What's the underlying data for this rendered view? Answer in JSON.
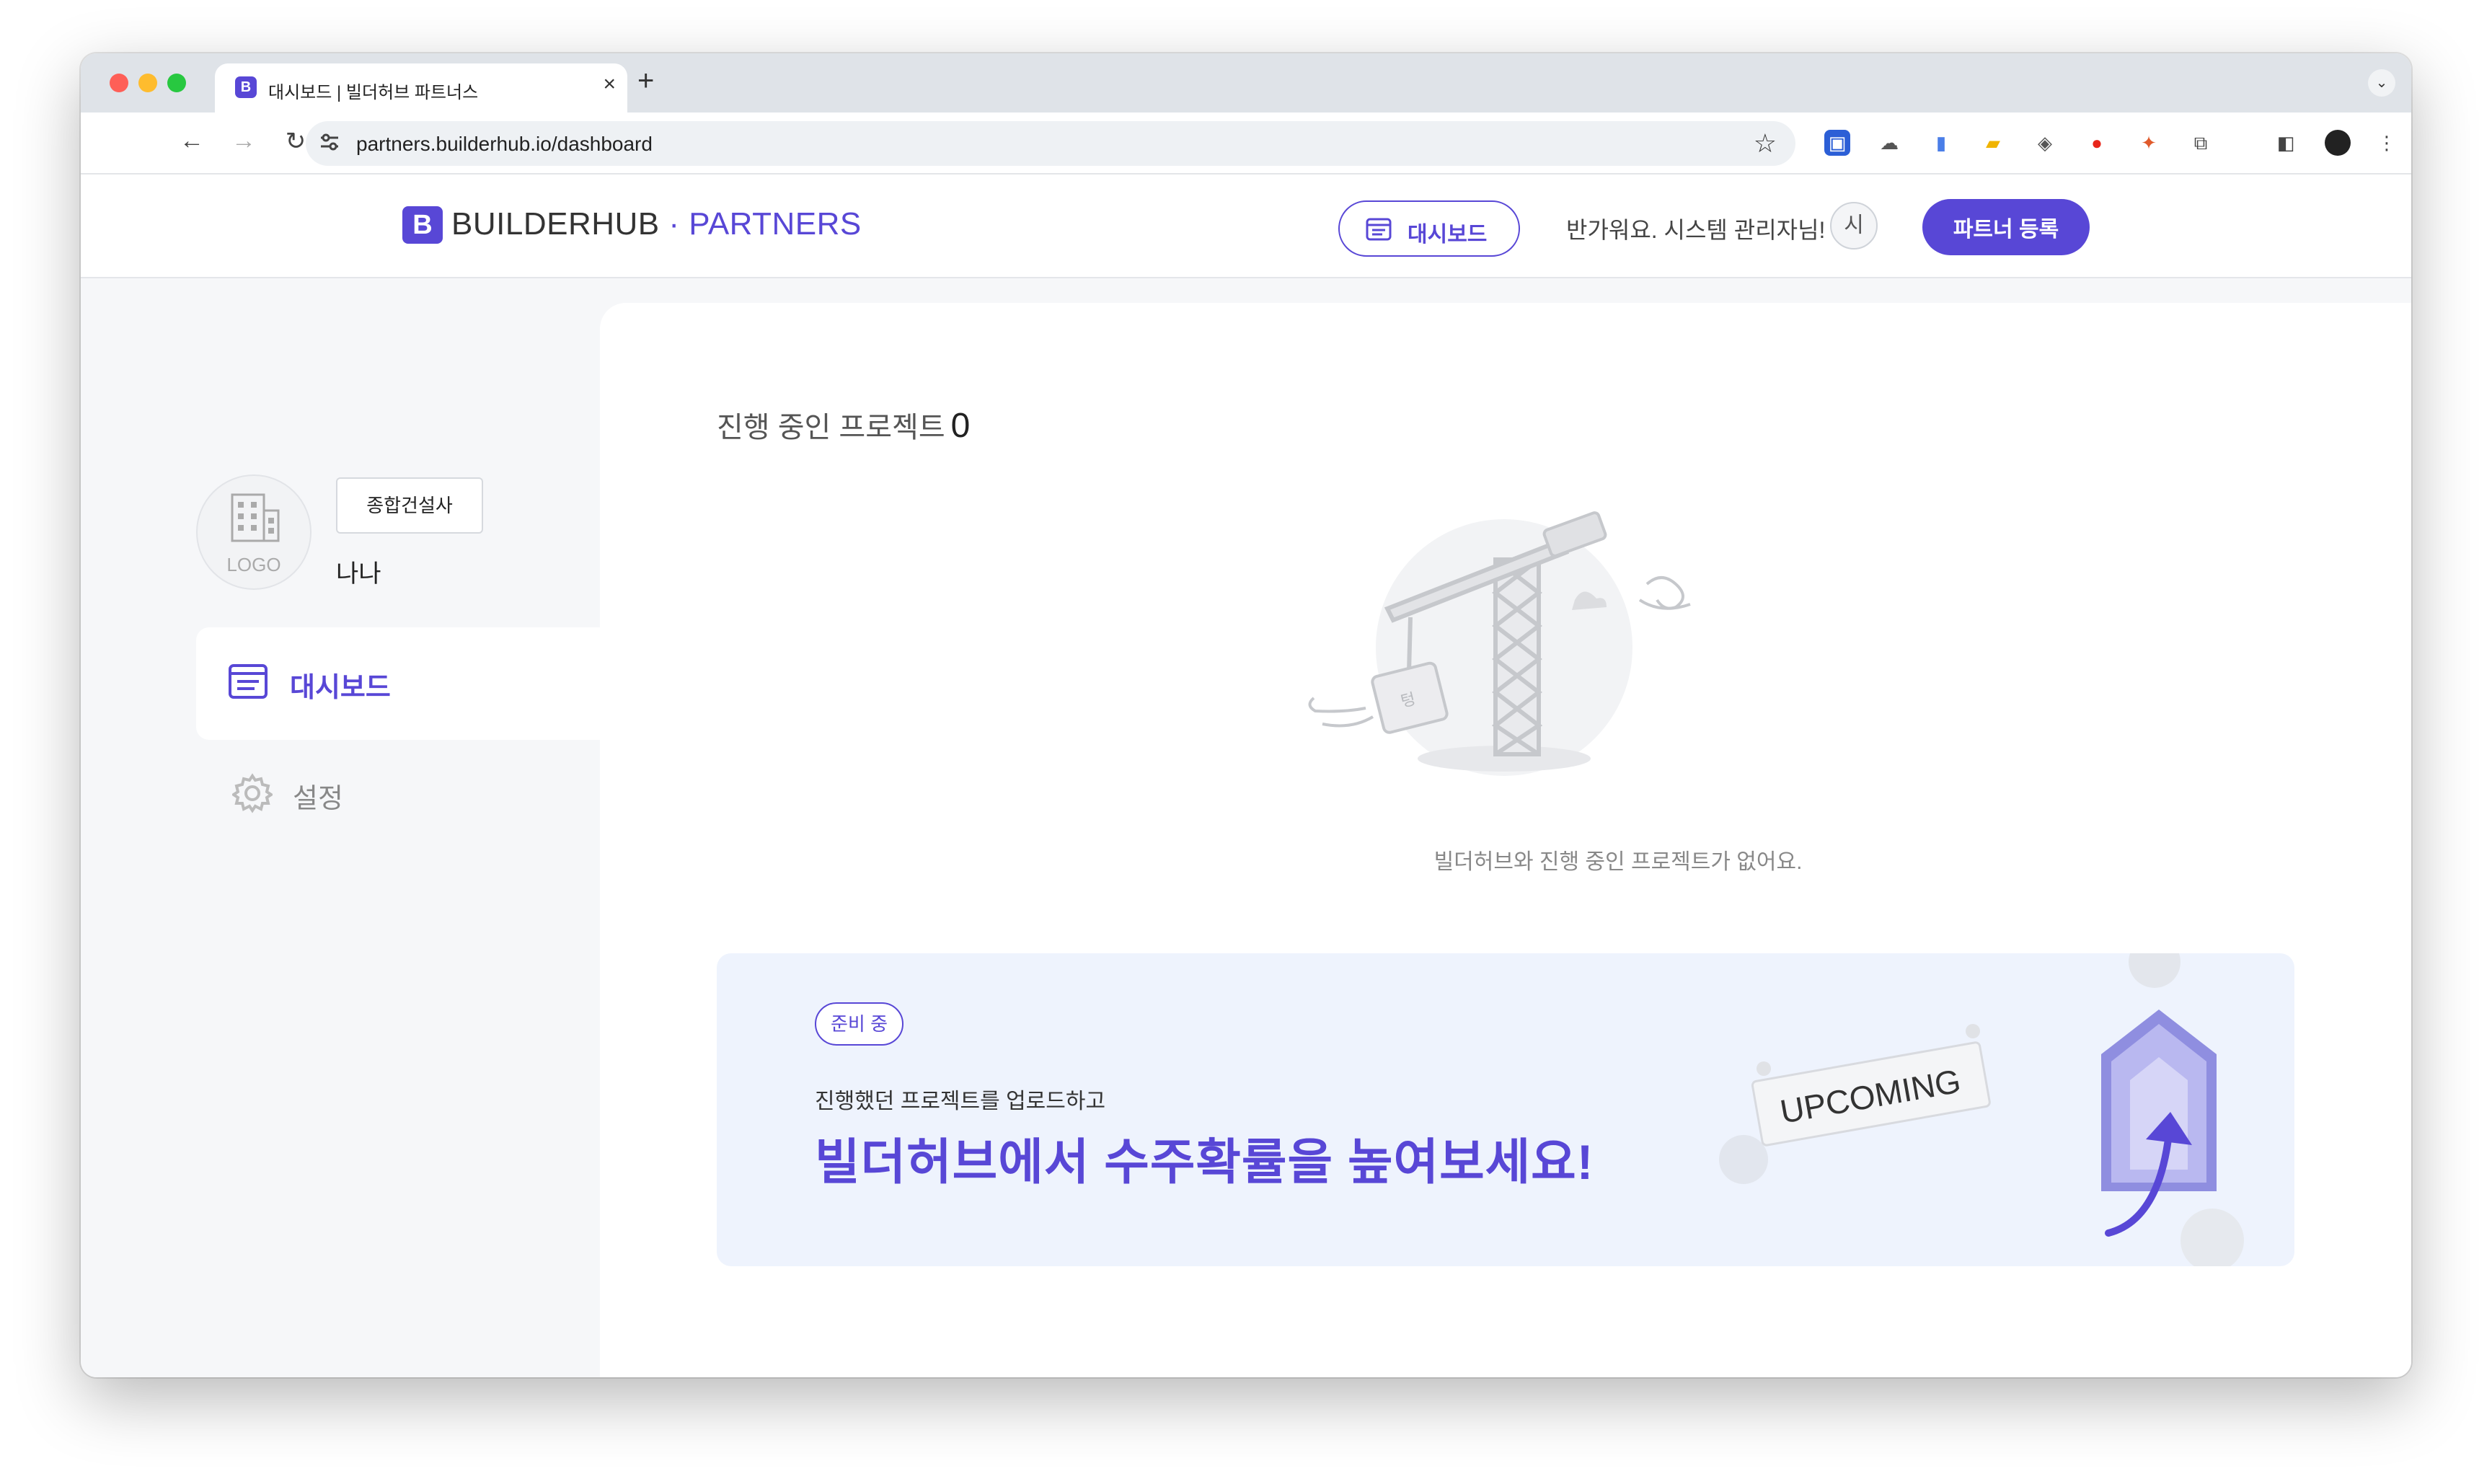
{
  "browser": {
    "tab_title": "대시보드 | 빌더허브 파트너스",
    "tab_close": "×",
    "new_tab": "+",
    "url": "partners.builderhub.io/dashboard"
  },
  "header": {
    "logo_letter": "B",
    "logo_brand": "BUILDERHUB",
    "logo_dot": " · ",
    "logo_sub": "PARTNERS",
    "dashboard_button": "대시보드",
    "greeting": "반가워요. 시스템 관리자님!",
    "avatar_initial": "시",
    "register_button": "파트너 등록"
  },
  "sidebar": {
    "logo_placeholder": "LOGO",
    "company_type": "종합건설사",
    "company_name": "나나",
    "items": [
      {
        "label": "대시보드",
        "icon": "dashboard-icon",
        "active": true
      },
      {
        "label": "설정",
        "icon": "gear-icon",
        "active": false
      }
    ]
  },
  "main": {
    "count_label": "진행 중인 프로젝트",
    "count_value": "0",
    "empty_message": "빌더허브와 진행 중인 프로젝트가 없어요.",
    "banner": {
      "badge": "준비 중",
      "subtitle": "진행했던 프로젝트를 업로드하고",
      "title": "빌더허브에서 수주확률을 높여보세요!",
      "upcoming": "UPCOMING"
    }
  },
  "colors": {
    "accent": "#5847d6",
    "banner_bg": "#eef3fd",
    "body_bg": "#f6f7f9"
  }
}
